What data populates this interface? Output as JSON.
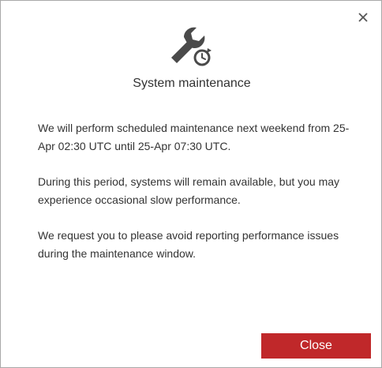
{
  "dialog": {
    "title": "System maintenance",
    "paragraphs": [
      "We will perform scheduled maintenance next weekend from 25-Apr 02:30 UTC until 25-Apr 07:30 UTC.",
      "During this period, systems will remain available, but you may experience occasional slow performance.",
      "We request you to please avoid reporting performance issues during the maintenance window."
    ],
    "close_button_label": "Close",
    "icons": {
      "header": "wrench-clock-icon",
      "dismiss": "close-icon"
    },
    "colors": {
      "primary_button": "#c0282a",
      "icon": "#4a4a4a",
      "text": "#333333"
    }
  }
}
